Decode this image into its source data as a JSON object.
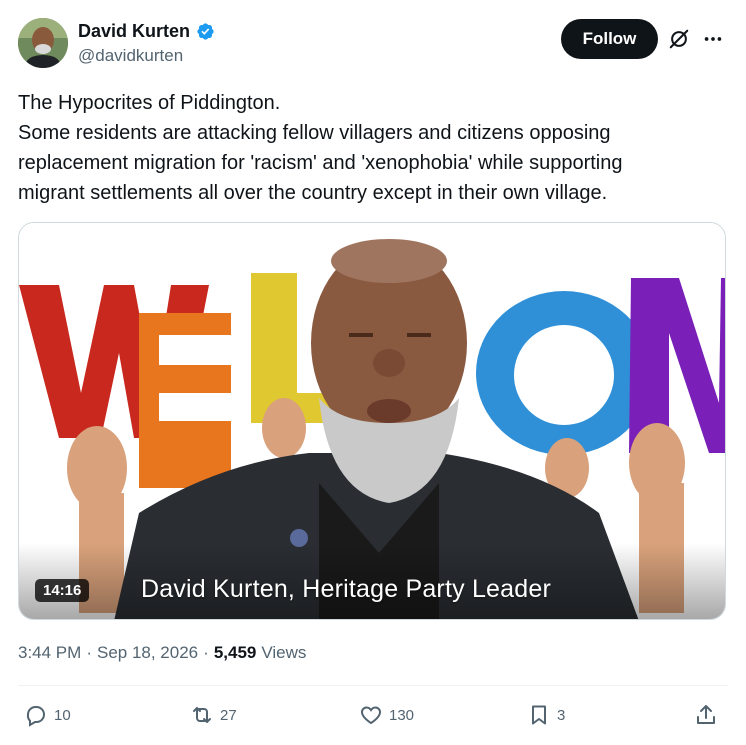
{
  "author": {
    "display_name": "David Kurten",
    "handle": "@davidkurten",
    "verified_icon": "verified-badge-icon",
    "avatar_icon": "avatar"
  },
  "header": {
    "follow_label": "Follow"
  },
  "tweet": {
    "lines": [
      "The Hypocrites of Piddington.",
      "Some residents are attacking fellow villagers and citizens opposing",
      "replacement migration for 'racism' and 'xenophobia' while supporting",
      "migrant settlements all over the country except in their own village."
    ]
  },
  "media": {
    "duration": "14:16",
    "caption": "David Kurten, Heritage Party Leader"
  },
  "meta": {
    "time": "3:44 PM",
    "separator": "·",
    "date": "Sep 18, 2026",
    "views_count": "5,459",
    "views_label": "Views"
  },
  "actions": {
    "replies": "10",
    "reposts": "27",
    "likes": "130",
    "bookmarks": "3"
  },
  "colors": {
    "text": "#0f1419",
    "secondary": "#536471",
    "verified": "#1d9bf0",
    "follow_bg": "#0f1419"
  }
}
